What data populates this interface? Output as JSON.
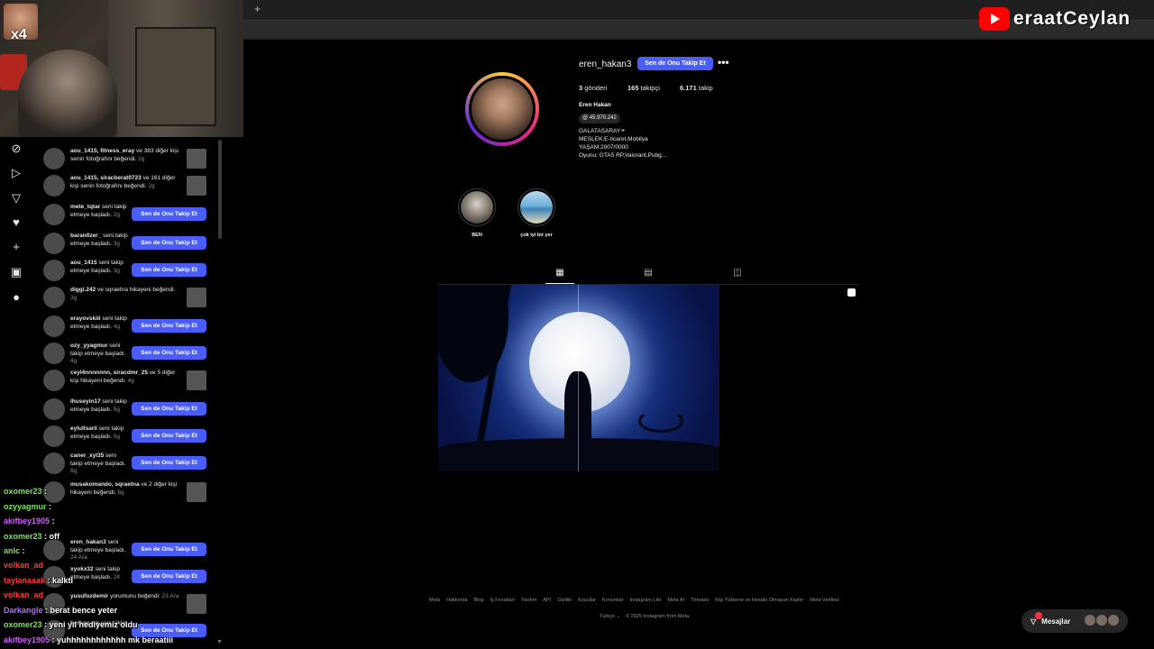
{
  "stream": {
    "multiplier": "x4",
    "brand_text": "eraatCeylan"
  },
  "browser": {
    "new_tab": "+",
    "controls": "—   ▢   ✕"
  },
  "notifications": {
    "follow_label": "Sen de Onu Takip Et",
    "items": [
      {
        "user": "aou_1415, fitness_eray",
        "text": " ve 383 diğer kişi senin fotoğrafını beğendi.",
        "time": "2g"
      },
      {
        "user": "aou_1415, siracberat0723",
        "text": " ve 161 diğer kişi senin fotoğrafını beğendi.",
        "time": "2g"
      },
      {
        "user": "mete_tqtar",
        "text": " seni takip etmeye başladı.",
        "time": "2g"
      },
      {
        "user": "baran0zer_",
        "text": " seni takip etmeye başladı.",
        "time": "3g"
      },
      {
        "user": "aou_1415",
        "text": " seni takip etmeye başladı.",
        "time": "3g"
      },
      {
        "user": "diggi.242",
        "text": " ve sqraetna hikayeni beğendi.",
        "time": "3g"
      },
      {
        "user": "erayovskiii",
        "text": " seni takip etmeye başladı.",
        "time": "4g"
      },
      {
        "user": "ozy_yyagmur",
        "text": " seni takip etmeye başladı.",
        "time": "4g"
      },
      {
        "user": "ceyl4nnnnnnn, siracdmr_25",
        "text": " ve 5 diğer kişi hikayeni beğendi.",
        "time": "4g"
      },
      {
        "user": "lhuseyin17",
        "text": " seni takip etmeye başladı.",
        "time": "5g"
      },
      {
        "user": "eylullsarii",
        "text": " seni takip etmeye başladı.",
        "time": "5g"
      },
      {
        "user": "caner_xyl35",
        "text": " seni takip etmeye başladı.",
        "time": "6g"
      },
      {
        "user": "musakomando, sqraetna",
        "text": " ve 2 diğer kişi hikayeni beğendi.",
        "time": "6g"
      },
      {
        "user": "eren_hakan3",
        "text": " seni takip etmeye başladı.",
        "time": "24 Ara"
      },
      {
        "user": "xyokx32",
        "text": " seni takip etmeye başladı.",
        "time": "24"
      },
      {
        "user": "yusufozdemir",
        "text": " yorumunu beğendi:",
        "time": "23 Ara"
      },
      {
        "user": "berkay_xx",
        "text": " seni takip",
        "time": ""
      }
    ]
  },
  "chat": [
    {
      "user": "oxomer23",
      "msg": " :",
      "color": "#7ee25a"
    },
    {
      "user": "ozyyagmur",
      "msg": " :",
      "color": "#7ee25a"
    },
    {
      "user": "akifbey1905",
      "msg": " :",
      "color": "#d35cff"
    },
    {
      "user": "oxomer23",
      "msg": " : off",
      "color": "#7ee25a"
    },
    {
      "user": "anlc",
      "msg": " :",
      "color": "#7ee25a"
    },
    {
      "user": "volkan_ad",
      "msg": "",
      "color": "#ff3b3b"
    },
    {
      "user": "taylanaaak",
      "msg": " : kalkti",
      "color": "#ff3b3b"
    },
    {
      "user": "volkan_ad",
      "msg": "",
      "color": "#ff3b3b"
    },
    {
      "user": "Darkangle",
      "msg": " : berat bence yeter",
      "color": "#b06cff"
    },
    {
      "user": "oxomer23",
      "msg": " : yeni yıl hediyemiz oldu",
      "color": "#7ee25a"
    },
    {
      "user": "akifbey1905",
      "msg": " : yuhhhhhhhhhhhh mk beraatiii",
      "color": "#d35cff"
    }
  ],
  "profile": {
    "username": "eren_hakan3",
    "follow_label": "Sen de Onu Takip Et",
    "more": "•••",
    "posts_count": "3",
    "posts_label": " gönderi",
    "followers_count": "165",
    "followers_label": " takipçi",
    "following_count": "6.171",
    "following_label": " takip",
    "full_name": "Eren Hakan",
    "threads_handle": "@ 45.970.242",
    "bio_lines": [
      "GALATASARAY⚭",
      "MESLEK:E-ticaret,Mobilya",
      "YAŞAM:2007/0000",
      "Oyunu: GTA5 RP,Valorant,Pubg..."
    ],
    "highlights": [
      {
        "label": "BEN"
      },
      {
        "label": "çok iyi bir yer"
      }
    ]
  },
  "footer": {
    "links": [
      "Meta",
      "Hakkında",
      "Blog",
      "İş Fırsatları",
      "Yardım",
      "API",
      "Gizlilik",
      "Koşullar",
      "Konumlar",
      "Instagram Lite",
      "Meta AI",
      "Threads",
      "Kişi Yükleme ve Hesabı Olmayan Kişiler",
      "Meta Verified"
    ],
    "language": "Türkçe ⌄",
    "copyright": "© 2025 Instagram from Meta"
  },
  "messages": {
    "label": "Mesajlar"
  },
  "colors": {
    "accent": "#4a5df9",
    "background": "#000000"
  }
}
